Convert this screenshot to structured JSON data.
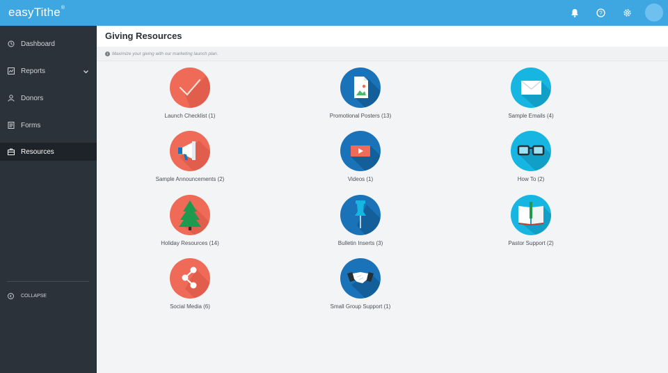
{
  "app": {
    "logo_text": "easyTithe",
    "logo_mark": "®"
  },
  "sidebar": {
    "items": [
      {
        "label": "Dashboard",
        "icon": "clock-icon"
      },
      {
        "label": "Reports",
        "icon": "chart-icon"
      },
      {
        "label": "Donors",
        "icon": "user-icon"
      },
      {
        "label": "Forms",
        "icon": "form-icon"
      },
      {
        "label": "Resources",
        "icon": "briefcase-icon"
      }
    ],
    "collapse_label": "COLLAPSE"
  },
  "header": {
    "title": "Giving Resources"
  },
  "info": {
    "text": "Maximize your giving with our marketing launch plan."
  },
  "resources": [
    {
      "label": "Launch Checklist (1)",
      "icon": "checkmark-icon",
      "color": "#ef6a57"
    },
    {
      "label": "Promotional Posters (13)",
      "icon": "poster-icon",
      "color": "#1a73b8"
    },
    {
      "label": "Sample Emails (4)",
      "icon": "envelope-icon",
      "color": "#17b6e2"
    },
    {
      "label": "Sample Announcements (2)",
      "icon": "megaphone-icon",
      "color": "#ef6a57"
    },
    {
      "label": "Videos (1)",
      "icon": "video-icon",
      "color": "#1a73b8"
    },
    {
      "label": "How To (2)",
      "icon": "glasses-icon",
      "color": "#17b6e2"
    },
    {
      "label": "Holiday Resources (14)",
      "icon": "tree-icon",
      "color": "#ef6a57"
    },
    {
      "label": "Bulletin Inserts (3)",
      "icon": "pushpin-icon",
      "color": "#1a73b8"
    },
    {
      "label": "Pastor Support (2)",
      "icon": "book-icon",
      "color": "#17b6e2"
    },
    {
      "label": "Social Media (6)",
      "icon": "share-icon",
      "color": "#ef6a57"
    },
    {
      "label": "Small Group Support (1)",
      "icon": "handshake-icon",
      "color": "#1a73b8"
    }
  ],
  "colors": {
    "topbar": "#3ea6e0",
    "sidebar": "#2c323a",
    "coral": "#ef6a57",
    "blue": "#1a73b8",
    "cyan": "#17b6e2"
  }
}
